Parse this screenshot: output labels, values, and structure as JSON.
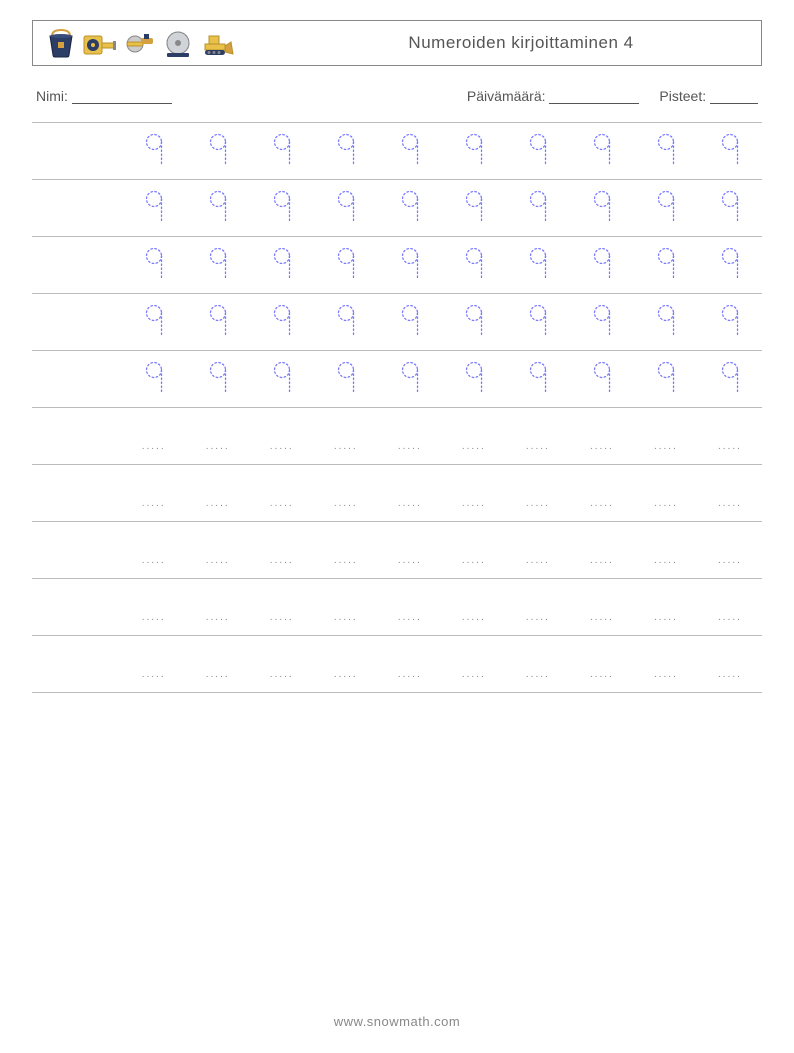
{
  "header": {
    "title": "Numeroiden kirjoittaminen 4"
  },
  "meta": {
    "name_label": "Nimi:",
    "date_label": "Päivämäärä:",
    "score_label": "Pisteet:"
  },
  "worksheet": {
    "rows": 10,
    "cols": 11,
    "trace_rows": 5,
    "blank_rows": 5,
    "trace_char": "9",
    "blank_placeholder": "....."
  },
  "footer": {
    "url": "www.snowmath.com"
  }
}
